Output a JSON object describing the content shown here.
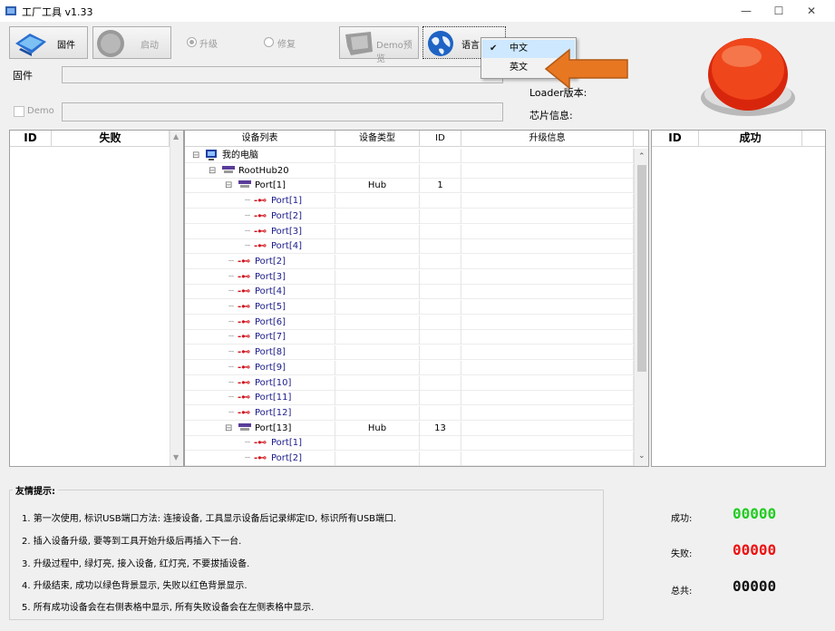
{
  "window": {
    "title": "工厂工具 v1.33",
    "minimize": "—",
    "maximize": "☐",
    "close": "✕"
  },
  "toolbar": {
    "firmware_button": "固件",
    "start_button": "启动",
    "upgrade_radio": "升级",
    "repair_radio": "修复",
    "demo_button": "Demo预览",
    "language_button": "语言"
  },
  "language_menu": {
    "items": [
      {
        "label": "中文",
        "checked": true
      },
      {
        "label": "英文",
        "checked": false
      }
    ]
  },
  "fields": {
    "firmware_label": "固件",
    "firmware_value": "",
    "demo_label": "Demo",
    "demo_checked": false,
    "demo_value": "",
    "loader_label": "Loader版本:",
    "chip_label": "芯片信息:"
  },
  "fail_table": {
    "headers": [
      "ID",
      "失败"
    ]
  },
  "success_table": {
    "headers": [
      "ID",
      "成功"
    ]
  },
  "device_table": {
    "headers": [
      "设备列表",
      "设备类型",
      "ID",
      "升级信息"
    ],
    "rows": [
      {
        "label": "我的电脑",
        "type": "",
        "id": "",
        "kind": "computer",
        "indent": 0,
        "expander": "⊟"
      },
      {
        "label": "RootHub20",
        "type": "",
        "id": "",
        "kind": "hub",
        "indent": 1,
        "expander": "⊟"
      },
      {
        "label": "Port[1]",
        "type": "Hub",
        "id": "1",
        "kind": "hub",
        "indent": 2,
        "expander": "⊟"
      },
      {
        "label": "Port[1]",
        "type": "",
        "id": "",
        "kind": "usb",
        "indent": 3,
        "expander": ""
      },
      {
        "label": "Port[2]",
        "type": "",
        "id": "",
        "kind": "usb",
        "indent": 3,
        "expander": ""
      },
      {
        "label": "Port[3]",
        "type": "",
        "id": "",
        "kind": "usb",
        "indent": 3,
        "expander": ""
      },
      {
        "label": "Port[4]",
        "type": "",
        "id": "",
        "kind": "usb",
        "indent": 3,
        "expander": ""
      },
      {
        "label": "Port[2]",
        "type": "",
        "id": "",
        "kind": "usb",
        "indent": 2,
        "expander": ""
      },
      {
        "label": "Port[3]",
        "type": "",
        "id": "",
        "kind": "usb",
        "indent": 2,
        "expander": ""
      },
      {
        "label": "Port[4]",
        "type": "",
        "id": "",
        "kind": "usb",
        "indent": 2,
        "expander": ""
      },
      {
        "label": "Port[5]",
        "type": "",
        "id": "",
        "kind": "usb",
        "indent": 2,
        "expander": ""
      },
      {
        "label": "Port[6]",
        "type": "",
        "id": "",
        "kind": "usb",
        "indent": 2,
        "expander": ""
      },
      {
        "label": "Port[7]",
        "type": "",
        "id": "",
        "kind": "usb",
        "indent": 2,
        "expander": ""
      },
      {
        "label": "Port[8]",
        "type": "",
        "id": "",
        "kind": "usb",
        "indent": 2,
        "expander": ""
      },
      {
        "label": "Port[9]",
        "type": "",
        "id": "",
        "kind": "usb",
        "indent": 2,
        "expander": ""
      },
      {
        "label": "Port[10]",
        "type": "",
        "id": "",
        "kind": "usb",
        "indent": 2,
        "expander": ""
      },
      {
        "label": "Port[11]",
        "type": "",
        "id": "",
        "kind": "usb",
        "indent": 2,
        "expander": ""
      },
      {
        "label": "Port[12]",
        "type": "",
        "id": "",
        "kind": "usb",
        "indent": 2,
        "expander": ""
      },
      {
        "label": "Port[13]",
        "type": "Hub",
        "id": "13",
        "kind": "hub",
        "indent": 2,
        "expander": "⊟"
      },
      {
        "label": "Port[1]",
        "type": "",
        "id": "",
        "kind": "usb",
        "indent": 3,
        "expander": ""
      },
      {
        "label": "Port[2]",
        "type": "",
        "id": "",
        "kind": "usb",
        "indent": 3,
        "expander": ""
      }
    ]
  },
  "tips": {
    "title": "友情提示:",
    "lines": [
      "1. 第一次使用, 标识USB端口方法: 连接设备, 工具显示设备后记录绑定ID, 标识所有USB端口.",
      "2. 插入设备升级, 要等到工具开始升级后再插入下一台.",
      "3. 升级过程中, 绿灯亮, 接入设备, 红灯亮, 不要拔插设备.",
      "4. 升级结束, 成功以绿色背景显示, 失败以红色背景显示.",
      "5. 所有成功设备会在右侧表格中显示, 所有失败设备会在左侧表格中显示."
    ]
  },
  "stats": {
    "success_label": "成功:",
    "success_value": "00000",
    "fail_label": "失败:",
    "fail_value": "00000",
    "total_label": "总共:",
    "total_value": "00000"
  },
  "colors": {
    "success": "#22cc22",
    "fail": "#ee1111",
    "total": "#111111",
    "arrow": "#e87722",
    "status_light": "#e53012"
  },
  "icons": [
    "app-icon",
    "firmware-icon",
    "start-icon",
    "demo-icon",
    "globe-icon",
    "check-icon",
    "status-light-icon",
    "arrow-pointer",
    "computer-icon",
    "hub-icon",
    "usb-icon"
  ]
}
